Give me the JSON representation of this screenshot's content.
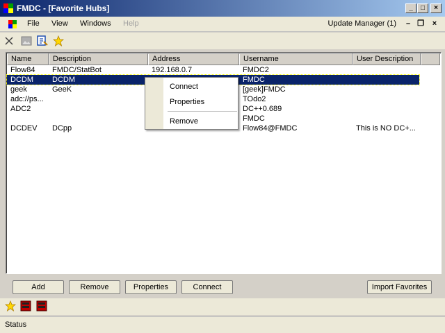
{
  "window": {
    "title": "FMDC - [Favorite Hubs]",
    "minimize_label": "_",
    "maximize_label": "□",
    "close_label": "×"
  },
  "menubar": {
    "items": [
      {
        "label": "File"
      },
      {
        "label": "View"
      },
      {
        "label": "Windows"
      },
      {
        "label": "Help",
        "disabled": true
      }
    ],
    "update_manager": "Update Manager (1)",
    "mdi_minimize": "–",
    "mdi_restore": "❐",
    "mdi_close": "×"
  },
  "toolbar": {
    "icons": [
      "network-icon",
      "image-icon",
      "hub-settings-icon",
      "favorite-star-icon"
    ]
  },
  "list": {
    "columns": [
      "Name",
      "Description",
      "Address",
      "Username",
      "User Description"
    ],
    "rows": [
      {
        "name": "Flow84",
        "description": "FMDC/StatBot",
        "address": "192.168.0.7",
        "username": "FMDC2",
        "user_description": ""
      },
      {
        "name": "DCDM",
        "description": "DCDM",
        "address": "",
        "username": "FMDC",
        "user_description": "",
        "selected": true
      },
      {
        "name": "geek",
        "description": "GeeK",
        "address": "",
        "username": "[geek]FMDC",
        "user_description": ""
      },
      {
        "name": "adc://ps...",
        "description": "",
        "address": "",
        "username": "TOdo2",
        "user_description": ""
      },
      {
        "name": "ADC2",
        "description": "",
        "address": "",
        "username": "DC++0.689",
        "user_description": ""
      },
      {
        "name": "",
        "description": "",
        "address": "",
        "username": "FMDC",
        "user_description": ""
      },
      {
        "name": "DCDEV",
        "description": "DCpp",
        "address": "",
        "username": "Flow84@FMDC",
        "user_description": "This is NO DC+..."
      }
    ]
  },
  "context_menu": {
    "items": [
      "Connect",
      "Properties",
      "Remove"
    ]
  },
  "buttons": {
    "add": "Add",
    "remove": "Remove",
    "properties": "Properties",
    "connect": "Connect",
    "import_favorites": "Import Favorites"
  },
  "bottom_toolbar": {
    "icons": [
      "favorite-star-icon",
      "hub-red-icon",
      "hub-red-icon"
    ]
  },
  "status": {
    "text": "Status"
  },
  "colors": {
    "title_gradient_start": "#0a246a",
    "selection": "#0a246a",
    "star": "#ffd700",
    "hub_red": "#c00000"
  }
}
